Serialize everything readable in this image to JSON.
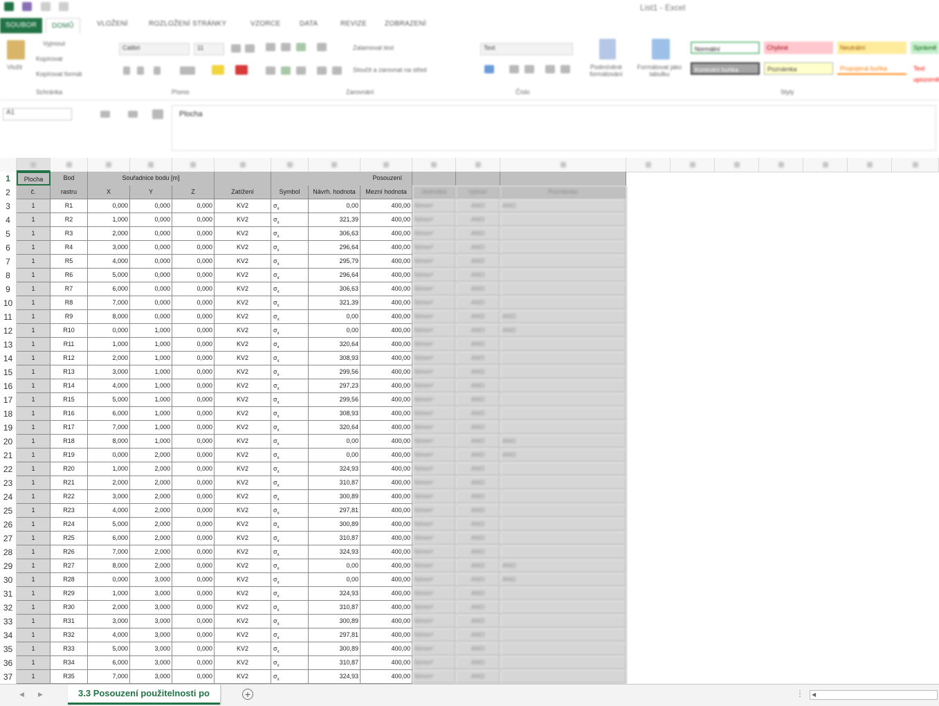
{
  "window": {
    "title": "List1 - Excel"
  },
  "ribbon": {
    "tabs": [
      "SOUBOR",
      "DOMŮ",
      "VLOŽENÍ",
      "ROZLOŽENÍ STRÁNKY",
      "VZORCE",
      "DATA",
      "REVIZE",
      "ZOBRAZENÍ"
    ],
    "clipboard": {
      "paste": "Vložit",
      "cut": "Vyjmout",
      "copy": "Kopírovat",
      "format_painter": "Kopírovat formát",
      "group": "Schránka"
    },
    "font": {
      "name": "Calibri",
      "size": "11",
      "group": "Písmo"
    },
    "alignment": {
      "wrap": "Zalamovat text",
      "merge": "Sloučit a zarovnat na střed",
      "group": "Zarovnání"
    },
    "number": {
      "format": "Text",
      "group": "Číslo"
    },
    "styles": {
      "conditional": "Podmíněné formátování",
      "table": "Formátovat jako tabulku",
      "cells": [
        {
          "label": "Normální",
          "bg": "#ffffff",
          "color": "#000000"
        },
        {
          "label": "Chybné",
          "bg": "#ffc7ce",
          "color": "#9c0006"
        },
        {
          "label": "Neutrální",
          "bg": "#ffeb9c",
          "color": "#9c5700"
        },
        {
          "label": "Správně",
          "bg": "#c6efce",
          "color": "#006100"
        },
        {
          "label": "Kontrolní buňka",
          "bg": "#a5a5a5",
          "color": "#ffffff"
        },
        {
          "label": "Poznámka",
          "bg": "#ffffcc",
          "color": "#444444"
        },
        {
          "label": "Propojená buňka",
          "bg": "#ffffff",
          "color": "#fa7d00"
        },
        {
          "label": "Text upozornění",
          "bg": "#ffffff",
          "color": "#ff0000"
        }
      ],
      "group": "Styly"
    }
  },
  "formula_bar": {
    "name_box": "A1",
    "content": "Plocha"
  },
  "sheet": {
    "header_row1": {
      "row": "1",
      "plocha": "Plocha",
      "bod": "Bod",
      "souradnice": "Souřadnice bodu [m]",
      "posouzeni": "Posouzení"
    },
    "header_row2": {
      "row": "2",
      "plocha": "č.",
      "bod": "rastru",
      "x": "X",
      "y": "Y",
      "z": "Z",
      "zatizeni": "Zatížení",
      "symbol": "Symbol",
      "navrh": "Návrh. hodnota",
      "mezni": "Mezní hodnota",
      "jednotka": "Jednotka",
      "vyhovi": "Vyhoví",
      "poznamka": "Poznámka"
    },
    "rows": [
      {
        "n": "3",
        "plocha": "1",
        "bod": "R1",
        "x": "0,000",
        "y": "0,000",
        "z": "0,000",
        "zat": "KV2",
        "navrh": "0,00",
        "mezni": "400,00",
        "jed": "N/mm²",
        "vyh": "ANO",
        "note": "ANO"
      },
      {
        "n": "4",
        "plocha": "1",
        "bod": "R2",
        "x": "1,000",
        "y": "0,000",
        "z": "0,000",
        "zat": "KV2",
        "navrh": "321,39",
        "mezni": "400,00",
        "jed": "N/mm²",
        "vyh": "ANO",
        "note": ""
      },
      {
        "n": "5",
        "plocha": "1",
        "bod": "R3",
        "x": "2,000",
        "y": "0,000",
        "z": "0,000",
        "zat": "KV2",
        "navrh": "306,63",
        "mezni": "400,00",
        "jed": "N/mm²",
        "vyh": "ANO",
        "note": ""
      },
      {
        "n": "6",
        "plocha": "1",
        "bod": "R4",
        "x": "3,000",
        "y": "0,000",
        "z": "0,000",
        "zat": "KV2",
        "navrh": "296,64",
        "mezni": "400,00",
        "jed": "N/mm²",
        "vyh": "ANO",
        "note": ""
      },
      {
        "n": "7",
        "plocha": "1",
        "bod": "R5",
        "x": "4,000",
        "y": "0,000",
        "z": "0,000",
        "zat": "KV2",
        "navrh": "295,79",
        "mezni": "400,00",
        "jed": "N/mm²",
        "vyh": "ANO",
        "note": ""
      },
      {
        "n": "8",
        "plocha": "1",
        "bod": "R6",
        "x": "5,000",
        "y": "0,000",
        "z": "0,000",
        "zat": "KV2",
        "navrh": "296,64",
        "mezni": "400,00",
        "jed": "N/mm²",
        "vyh": "ANO",
        "note": ""
      },
      {
        "n": "9",
        "plocha": "1",
        "bod": "R7",
        "x": "6,000",
        "y": "0,000",
        "z": "0,000",
        "zat": "KV2",
        "navrh": "306,63",
        "mezni": "400,00",
        "jed": "N/mm²",
        "vyh": "ANO",
        "note": ""
      },
      {
        "n": "10",
        "plocha": "1",
        "bod": "R8",
        "x": "7,000",
        "y": "0,000",
        "z": "0,000",
        "zat": "KV2",
        "navrh": "321,39",
        "mezni": "400,00",
        "jed": "N/mm²",
        "vyh": "ANO",
        "note": ""
      },
      {
        "n": "11",
        "plocha": "1",
        "bod": "R9",
        "x": "8,000",
        "y": "0,000",
        "z": "0,000",
        "zat": "KV2",
        "navrh": "0,00",
        "mezni": "400,00",
        "jed": "N/mm²",
        "vyh": "ANO",
        "note": "ANO"
      },
      {
        "n": "12",
        "plocha": "1",
        "bod": "R10",
        "x": "0,000",
        "y": "1,000",
        "z": "0,000",
        "zat": "KV2",
        "navrh": "0,00",
        "mezni": "400,00",
        "jed": "N/mm²",
        "vyh": "ANO",
        "note": "ANO"
      },
      {
        "n": "13",
        "plocha": "1",
        "bod": "R11",
        "x": "1,000",
        "y": "1,000",
        "z": "0,000",
        "zat": "KV2",
        "navrh": "320,64",
        "mezni": "400,00",
        "jed": "N/mm²",
        "vyh": "ANO",
        "note": ""
      },
      {
        "n": "14",
        "plocha": "1",
        "bod": "R12",
        "x": "2,000",
        "y": "1,000",
        "z": "0,000",
        "zat": "KV2",
        "navrh": "308,93",
        "mezni": "400,00",
        "jed": "N/mm²",
        "vyh": "ANO",
        "note": ""
      },
      {
        "n": "15",
        "plocha": "1",
        "bod": "R13",
        "x": "3,000",
        "y": "1,000",
        "z": "0,000",
        "zat": "KV2",
        "navrh": "299,56",
        "mezni": "400,00",
        "jed": "N/mm²",
        "vyh": "ANO",
        "note": ""
      },
      {
        "n": "16",
        "plocha": "1",
        "bod": "R14",
        "x": "4,000",
        "y": "1,000",
        "z": "0,000",
        "zat": "KV2",
        "navrh": "297,23",
        "mezni": "400,00",
        "jed": "N/mm²",
        "vyh": "ANO",
        "note": ""
      },
      {
        "n": "17",
        "plocha": "1",
        "bod": "R15",
        "x": "5,000",
        "y": "1,000",
        "z": "0,000",
        "zat": "KV2",
        "navrh": "299,56",
        "mezni": "400,00",
        "jed": "N/mm²",
        "vyh": "ANO",
        "note": ""
      },
      {
        "n": "18",
        "plocha": "1",
        "bod": "R16",
        "x": "6,000",
        "y": "1,000",
        "z": "0,000",
        "zat": "KV2",
        "navrh": "308,93",
        "mezni": "400,00",
        "jed": "N/mm²",
        "vyh": "ANO",
        "note": ""
      },
      {
        "n": "19",
        "plocha": "1",
        "bod": "R17",
        "x": "7,000",
        "y": "1,000",
        "z": "0,000",
        "zat": "KV2",
        "navrh": "320,64",
        "mezni": "400,00",
        "jed": "N/mm²",
        "vyh": "ANO",
        "note": ""
      },
      {
        "n": "20",
        "plocha": "1",
        "bod": "R18",
        "x": "8,000",
        "y": "1,000",
        "z": "0,000",
        "zat": "KV2",
        "navrh": "0,00",
        "mezni": "400,00",
        "jed": "N/mm²",
        "vyh": "ANO",
        "note": "ANO"
      },
      {
        "n": "21",
        "plocha": "1",
        "bod": "R19",
        "x": "0,000",
        "y": "2,000",
        "z": "0,000",
        "zat": "KV2",
        "navrh": "0,00",
        "mezni": "400,00",
        "jed": "N/mm²",
        "vyh": "ANO",
        "note": "ANO"
      },
      {
        "n": "22",
        "plocha": "1",
        "bod": "R20",
        "x": "1,000",
        "y": "2,000",
        "z": "0,000",
        "zat": "KV2",
        "navrh": "324,93",
        "mezni": "400,00",
        "jed": "N/mm²",
        "vyh": "ANO",
        "note": ""
      },
      {
        "n": "23",
        "plocha": "1",
        "bod": "R21",
        "x": "2,000",
        "y": "2,000",
        "z": "0,000",
        "zat": "KV2",
        "navrh": "310,87",
        "mezni": "400,00",
        "jed": "N/mm²",
        "vyh": "ANO",
        "note": ""
      },
      {
        "n": "24",
        "plocha": "1",
        "bod": "R22",
        "x": "3,000",
        "y": "2,000",
        "z": "0,000",
        "zat": "KV2",
        "navrh": "300,89",
        "mezni": "400,00",
        "jed": "N/mm²",
        "vyh": "ANO",
        "note": ""
      },
      {
        "n": "25",
        "plocha": "1",
        "bod": "R23",
        "x": "4,000",
        "y": "2,000",
        "z": "0,000",
        "zat": "KV2",
        "navrh": "297,81",
        "mezni": "400,00",
        "jed": "N/mm²",
        "vyh": "ANO",
        "note": ""
      },
      {
        "n": "26",
        "plocha": "1",
        "bod": "R24",
        "x": "5,000",
        "y": "2,000",
        "z": "0,000",
        "zat": "KV2",
        "navrh": "300,89",
        "mezni": "400,00",
        "jed": "N/mm²",
        "vyh": "ANO",
        "note": ""
      },
      {
        "n": "27",
        "plocha": "1",
        "bod": "R25",
        "x": "6,000",
        "y": "2,000",
        "z": "0,000",
        "zat": "KV2",
        "navrh": "310,87",
        "mezni": "400,00",
        "jed": "N/mm²",
        "vyh": "ANO",
        "note": ""
      },
      {
        "n": "28",
        "plocha": "1",
        "bod": "R26",
        "x": "7,000",
        "y": "2,000",
        "z": "0,000",
        "zat": "KV2",
        "navrh": "324,93",
        "mezni": "400,00",
        "jed": "N/mm²",
        "vyh": "ANO",
        "note": ""
      },
      {
        "n": "29",
        "plocha": "1",
        "bod": "R27",
        "x": "8,000",
        "y": "2,000",
        "z": "0,000",
        "zat": "KV2",
        "navrh": "0,00",
        "mezni": "400,00",
        "jed": "N/mm²",
        "vyh": "ANO",
        "note": "ANO"
      },
      {
        "n": "30",
        "plocha": "1",
        "bod": "R28",
        "x": "0,000",
        "y": "3,000",
        "z": "0,000",
        "zat": "KV2",
        "navrh": "0,00",
        "mezni": "400,00",
        "jed": "N/mm²",
        "vyh": "ANO",
        "note": "ANO"
      },
      {
        "n": "31",
        "plocha": "1",
        "bod": "R29",
        "x": "1,000",
        "y": "3,000",
        "z": "0,000",
        "zat": "KV2",
        "navrh": "324,93",
        "mezni": "400,00",
        "jed": "N/mm²",
        "vyh": "ANO",
        "note": ""
      },
      {
        "n": "32",
        "plocha": "1",
        "bod": "R30",
        "x": "2,000",
        "y": "3,000",
        "z": "0,000",
        "zat": "KV2",
        "navrh": "310,87",
        "mezni": "400,00",
        "jed": "N/mm²",
        "vyh": "ANO",
        "note": ""
      },
      {
        "n": "33",
        "plocha": "1",
        "bod": "R31",
        "x": "3,000",
        "y": "3,000",
        "z": "0,000",
        "zat": "KV2",
        "navrh": "300,89",
        "mezni": "400,00",
        "jed": "N/mm²",
        "vyh": "ANO",
        "note": ""
      },
      {
        "n": "34",
        "plocha": "1",
        "bod": "R32",
        "x": "4,000",
        "y": "3,000",
        "z": "0,000",
        "zat": "KV2",
        "navrh": "297,81",
        "mezni": "400,00",
        "jed": "N/mm²",
        "vyh": "ANO",
        "note": ""
      },
      {
        "n": "35",
        "plocha": "1",
        "bod": "R33",
        "x": "5,000",
        "y": "3,000",
        "z": "0,000",
        "zat": "KV2",
        "navrh": "300,89",
        "mezni": "400,00",
        "jed": "N/mm²",
        "vyh": "ANO",
        "note": ""
      },
      {
        "n": "36",
        "plocha": "1",
        "bod": "R34",
        "x": "6,000",
        "y": "3,000",
        "z": "0,000",
        "zat": "KV2",
        "navrh": "310,87",
        "mezni": "400,00",
        "jed": "N/mm²",
        "vyh": "ANO",
        "note": ""
      },
      {
        "n": "37",
        "plocha": "1",
        "bod": "R35",
        "x": "7,000",
        "y": "3,000",
        "z": "0,000",
        "zat": "KV2",
        "navrh": "324,93",
        "mezni": "400,00",
        "jed": "N/mm²",
        "vyh": "ANO",
        "note": ""
      }
    ]
  },
  "sheet_tabs": {
    "active": "3.3 Posouzení použitelnosti po",
    "add": "+"
  },
  "colors": {
    "accent": "#217346",
    "header_gray": "#c0c0c0"
  }
}
